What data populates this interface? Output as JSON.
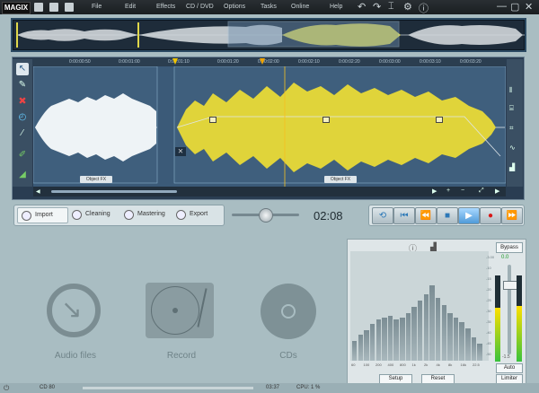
{
  "app": {
    "logo": "MAGIX"
  },
  "menu": [
    "File",
    "Edit",
    "Effects",
    "CD / DVD",
    "Options",
    "Tasks",
    "Online",
    "Help"
  ],
  "ruler_ticks": [
    "0:00:00:50",
    "0:00:01:00",
    "0:00:01:10",
    "0:00:01:20",
    "0:00:02:00",
    "0:00:02:10",
    "0:00:02:20",
    "0:00:03:00",
    "0:00:03:10",
    "0:00:03:20",
    "0:00:04:00"
  ],
  "objects": [
    {
      "label": "Object FX"
    },
    {
      "label": "Object FX"
    }
  ],
  "tabs": [
    {
      "label": "Import",
      "icon": "import-icon",
      "active": true
    },
    {
      "label": "Cleaning",
      "icon": "cleaning-icon",
      "active": false
    },
    {
      "label": "Mastering",
      "icon": "mastering-icon",
      "active": false
    },
    {
      "label": "Export",
      "icon": "export-icon",
      "active": false
    }
  ],
  "playback": {
    "time": "02:08"
  },
  "transport": [
    {
      "name": "loop-button",
      "glyph": "⟲"
    },
    {
      "name": "go-start-button",
      "glyph": "⏮"
    },
    {
      "name": "rewind-button",
      "glyph": "⏪"
    },
    {
      "name": "stop-button",
      "glyph": "■"
    },
    {
      "name": "play-button",
      "glyph": "▶"
    },
    {
      "name": "record-button",
      "glyph": "●"
    },
    {
      "name": "fast-forward-button",
      "glyph": "⏩"
    }
  ],
  "sources": [
    {
      "label": "Audio files",
      "icon": "audio-files-icon"
    },
    {
      "label": "Record",
      "icon": "turntable-icon"
    },
    {
      "label": "CDs",
      "icon": "cd-icon"
    }
  ],
  "meter": {
    "bypass": "Bypass",
    "setup": "Setup",
    "reset": "Reset",
    "auto": "Auto",
    "limiter": "Limiter",
    "gain": "0.0",
    "gain_bottom": "-1.5",
    "scale": [
      "-3.00",
      "-10",
      "-15",
      "-20",
      "-25",
      "-30",
      "-35",
      "-40",
      "-45",
      "-50"
    ],
    "freq_labels": [
      "60",
      "100",
      "200",
      "400",
      "800",
      "1k",
      "2k",
      "4k",
      "8k",
      "16k",
      "22.5"
    ],
    "bars": [
      0.18,
      0.24,
      0.28,
      0.34,
      0.38,
      0.4,
      0.42,
      0.38,
      0.4,
      0.44,
      0.5,
      0.56,
      0.62,
      0.7,
      0.58,
      0.52,
      0.44,
      0.4,
      0.36,
      0.3,
      0.22,
      0.16
    ]
  },
  "status": {
    "left": "CD 80",
    "time": "03:37",
    "cpu": "CPU: 1 %"
  }
}
